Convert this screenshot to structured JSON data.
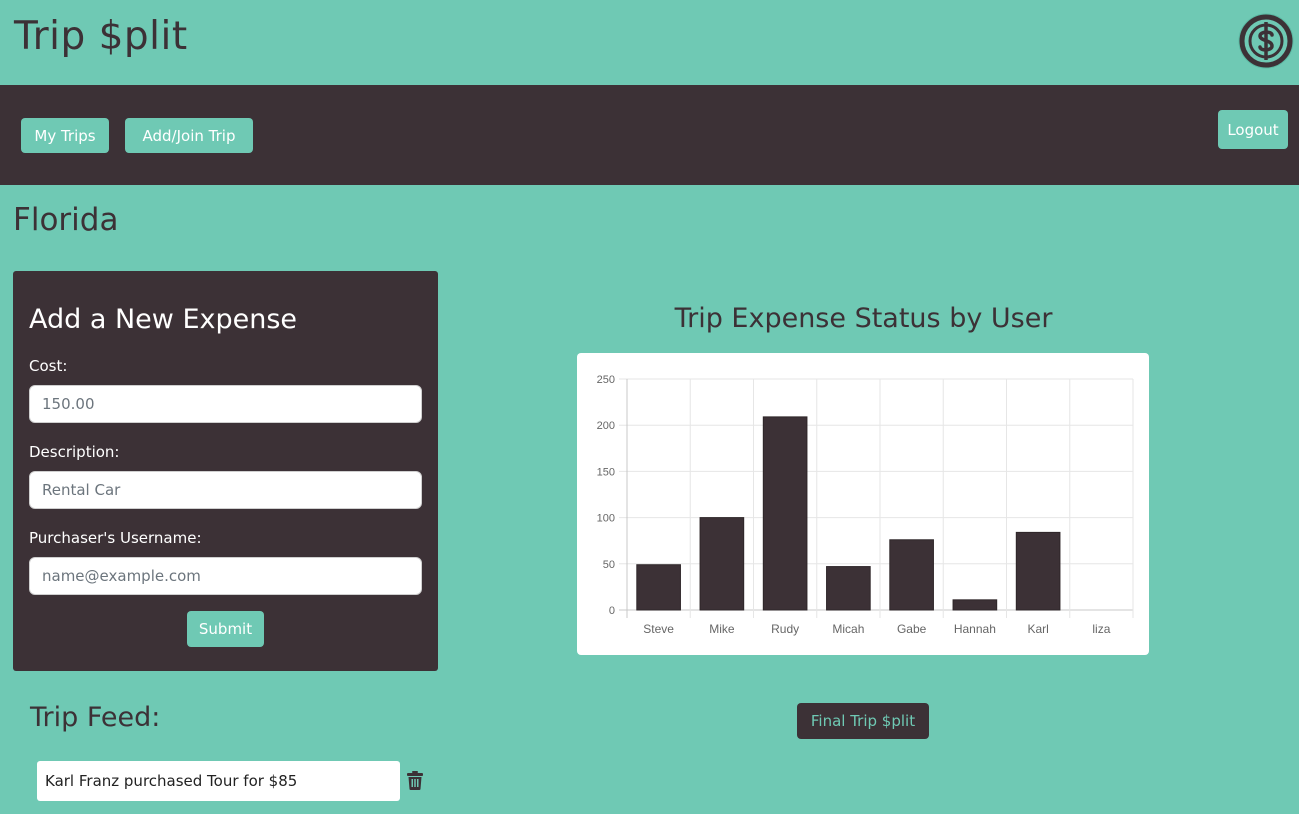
{
  "app": {
    "title": "Trip $plit",
    "logo_icon": "dollar-coin-logo-icon"
  },
  "nav": {
    "my_trips": "My Trips",
    "add_join": "Add/Join Trip",
    "logout": "Logout"
  },
  "page": {
    "title": "Florida"
  },
  "expense_form": {
    "title": "Add a New Expense",
    "cost_label": "Cost:",
    "cost_placeholder": "150.00",
    "description_label": "Description:",
    "description_placeholder": "Rental Car",
    "purchaser_label": "Purchaser's Username:",
    "purchaser_placeholder": "name@example.com",
    "submit": "Submit"
  },
  "chart_data": {
    "type": "bar",
    "title": "Trip Expense Status by User",
    "categories": [
      "Steve",
      "Mike",
      "Rudy",
      "Micah",
      "Gabe",
      "Hannah",
      "Karl",
      "liza"
    ],
    "values": [
      49,
      100,
      209,
      47,
      76,
      11,
      84,
      0
    ],
    "ylim": [
      0,
      250
    ],
    "yticks": [
      0,
      50,
      100,
      150,
      200,
      250
    ],
    "grid": true,
    "bar_color": "#3c3136"
  },
  "final_button": "Final Trip $plit",
  "feed": {
    "title": "Trip Feed:",
    "items": [
      {
        "text": "Karl Franz purchased Tour for $85",
        "icon": "trash-icon"
      }
    ]
  },
  "colors": {
    "background": "#6fc9b4",
    "dark": "#3c3136",
    "accent": "#6fc9b4"
  }
}
